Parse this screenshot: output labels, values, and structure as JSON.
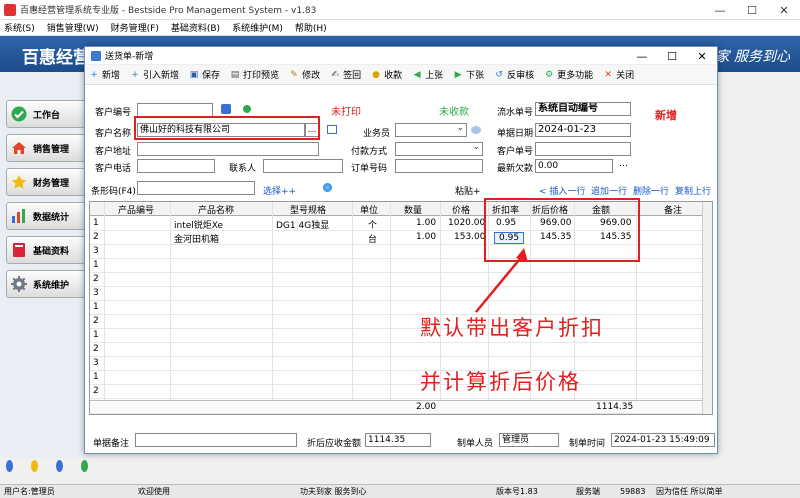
{
  "window": {
    "title": "百惠经营管理系统专业版 - Bestside Pro Management System - v1.83",
    "min": "—",
    "max": "☐",
    "close": "✕"
  },
  "menu": [
    "系统(S)",
    "销售管理(W)",
    "财务管理(F)",
    "基础资料(B)",
    "系统维护(M)",
    "帮助(H)"
  ],
  "banner": {
    "brand": "百惠经营",
    "slogan": "家  服务到心"
  },
  "nav": [
    {
      "label": "工作台",
      "icon": "checkmark-icon",
      "color": "#2fa84f"
    },
    {
      "label": "销售管理",
      "icon": "house-icon",
      "color": "#e0452b"
    },
    {
      "label": "财务管理",
      "icon": "star-icon",
      "color": "#f2b90f"
    },
    {
      "label": "数据统计",
      "icon": "bar-chart-icon",
      "color": "#3b6fd6"
    },
    {
      "label": "基础资料",
      "icon": "book-icon",
      "color": "#d9243a"
    },
    {
      "label": "系统维护",
      "icon": "gear-icon",
      "color": "#6f7a86"
    }
  ],
  "status": {
    "user": "用户名:管理员",
    "welcome": "欢迎使用",
    "motto": "功夫到家 服务到心",
    "version": "版本号1.83",
    "service": "服务端",
    "code": "59883",
    "trust": "因为信任 所以简单"
  },
  "dialog": {
    "title": "送货单-新增",
    "min": "—",
    "max": "☐",
    "close": "✕",
    "toolbar": [
      {
        "label": "新增",
        "icon": "plus-icon",
        "glyph": "+",
        "color": "#2a7de1"
      },
      {
        "label": "引入新增",
        "icon": "import-icon",
        "glyph": "+",
        "color": "#2a7de1"
      },
      {
        "label": "保存",
        "icon": "save-icon",
        "glyph": "▣",
        "color": "#2a5fb0"
      },
      {
        "label": "打印预览",
        "icon": "print-icon",
        "glyph": "▤",
        "color": "#555555"
      },
      {
        "label": "修改",
        "icon": "edit-icon",
        "glyph": "✎",
        "color": "#b07a1a"
      },
      {
        "label": "签回",
        "icon": "sign-icon",
        "glyph": "✍",
        "color": "#555555"
      },
      {
        "label": "收款",
        "icon": "coin-icon",
        "glyph": "●",
        "color": "#d9a400"
      },
      {
        "label": "上张",
        "icon": "prev-icon",
        "glyph": "◀",
        "color": "#2fa84f"
      },
      {
        "label": "下张",
        "icon": "next-icon",
        "glyph": "▶",
        "color": "#2fa84f"
      },
      {
        "label": "反审核",
        "icon": "unaudit-icon",
        "glyph": "↺",
        "color": "#2a7de1"
      },
      {
        "label": "更多功能",
        "icon": "more-icon",
        "glyph": "⚙",
        "color": "#2fa84f"
      },
      {
        "label": "关闭",
        "icon": "close-icon",
        "glyph": "✕",
        "color": "#e0452b"
      }
    ],
    "form": {
      "customer_code_label": "客户编号",
      "customer_code": "",
      "print_status": "未打印",
      "receipt_status": "未收款",
      "serial_label": "流水单号",
      "serial": "系统自动编号",
      "mode": "新增",
      "customer_name_label": "客户名称",
      "customer_name": "佛山好的科技有限公司",
      "salesman_label": "业务员",
      "salesman": "",
      "date_label": "单据日期",
      "date": "2024-01-23",
      "address_label": "客户地址",
      "address": "",
      "payment_label": "付款方式",
      "payment": "",
      "cust_order_label": "客户单号",
      "cust_order": "",
      "phone_label": "客户电话",
      "phone": "",
      "contact_label": "联系人",
      "contact": "",
      "order_no_label": "订单号码",
      "order_no": "",
      "arrears_label": "最新欠款",
      "arrears": "0.00",
      "barcode_label": "条形码(F4)",
      "barcode": "",
      "select_link": "选择++",
      "paste_link": "粘贴+",
      "insert_row": "插入一行",
      "append_row": "追加一行",
      "delete_row": "删除一行",
      "copy_row": "复制上行"
    },
    "table": {
      "headers": [
        "产品编号",
        "产品名称",
        "型号规格",
        "单位",
        "数量",
        "价格",
        "折扣率",
        "折后价格",
        "金额",
        "备注"
      ],
      "rows": [
        {
          "no": "1",
          "code": "",
          "name": "intel锐炬Xe",
          "spec": "DG1 4G独显",
          "unit": "个",
          "qty": "1.00",
          "price": "1020.00",
          "discount": "0.95",
          "disc_price": "969.00",
          "amount": "969.00",
          "remark": ""
        },
        {
          "no": "2",
          "code": "",
          "name": "金河田机箱",
          "spec": "",
          "unit": "台",
          "qty": "1.00",
          "price": "153.00",
          "discount": "0.95",
          "disc_price": "145.35",
          "amount": "145.35",
          "remark": ""
        }
      ],
      "empty_rows": [
        "3",
        "1",
        "2",
        "3",
        "1",
        "2",
        "1",
        "2",
        "3",
        "1",
        "2"
      ],
      "total_qty": "2.00",
      "total_amount": "1114.35"
    },
    "footer": {
      "remark_label": "单据备注",
      "remark": "",
      "receivable_label": "折后应收金额",
      "receivable": "1114.35",
      "maker_label": "制单人员",
      "maker": "管理员",
      "time_label": "制单时间",
      "time": "2024-01-23 15:49:09"
    }
  },
  "annotation": {
    "line1": "默认带出客户折扣",
    "line2": "并计算折后价格",
    "color": "#e02020"
  }
}
